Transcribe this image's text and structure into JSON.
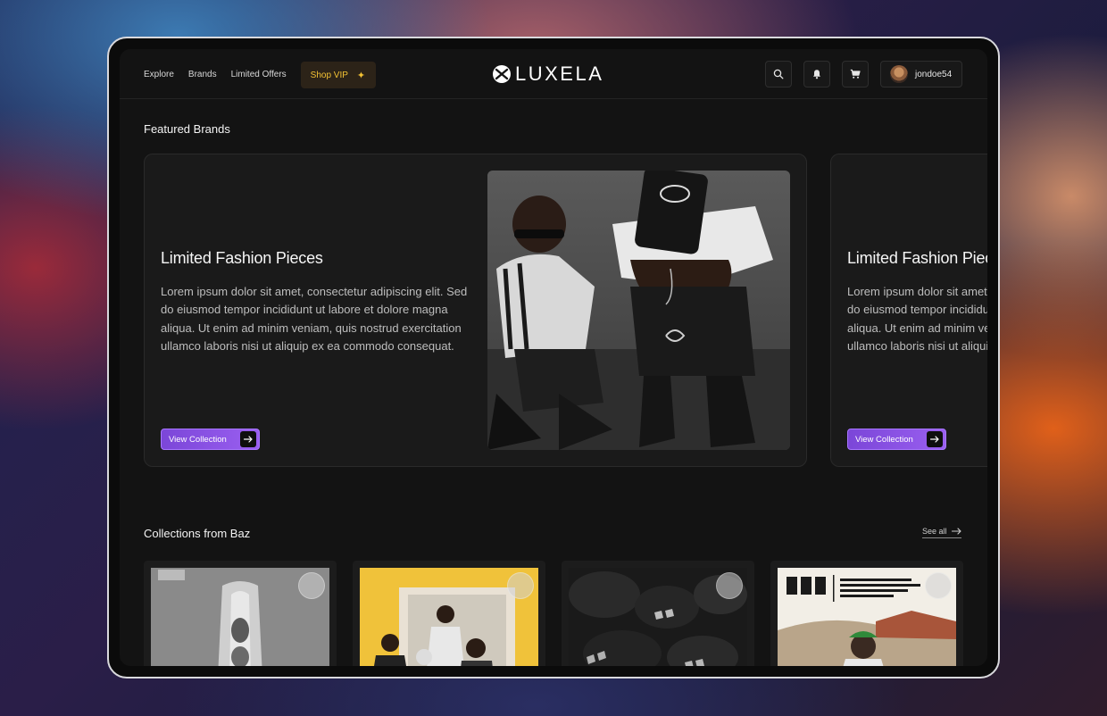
{
  "nav": {
    "links": [
      "Explore",
      "Brands",
      "Limited Offers"
    ],
    "vip_label": "Shop VIP"
  },
  "brand": {
    "name": "LUXELA"
  },
  "user": {
    "username": "jondoe54"
  },
  "featured": {
    "section_title": "Featured Brands",
    "cards": [
      {
        "title": "Limited Fashion Pieces",
        "description": "Lorem ipsum dolor sit amet, consectetur adipiscing elit. Sed do eiusmod tempor incididunt ut labore et dolore magna aliqua. Ut enim ad minim veniam, quis nostrud exercitation ullamco laboris nisi ut aliquip ex ea commodo consequat.",
        "button": "View Collection"
      },
      {
        "title": "Limited Fashion Pieces",
        "description": "Lorem ipsum dolor sit amet, consectetur adipiscing elit. Sed do eiusmod tempor incididunt ut labore et dolore magna aliqua. Ut enim ad minim veniam, quis nostrud exercitation ullamco laboris nisi ut aliquip ex ea commodo consequat.",
        "button": "View Collection"
      }
    ]
  },
  "collections": {
    "section_title": "Collections from Baz",
    "see_all": "See all"
  },
  "colors": {
    "accent_purple": "#8b52e6",
    "vip_gold": "#f3c234",
    "background": "#131313"
  }
}
